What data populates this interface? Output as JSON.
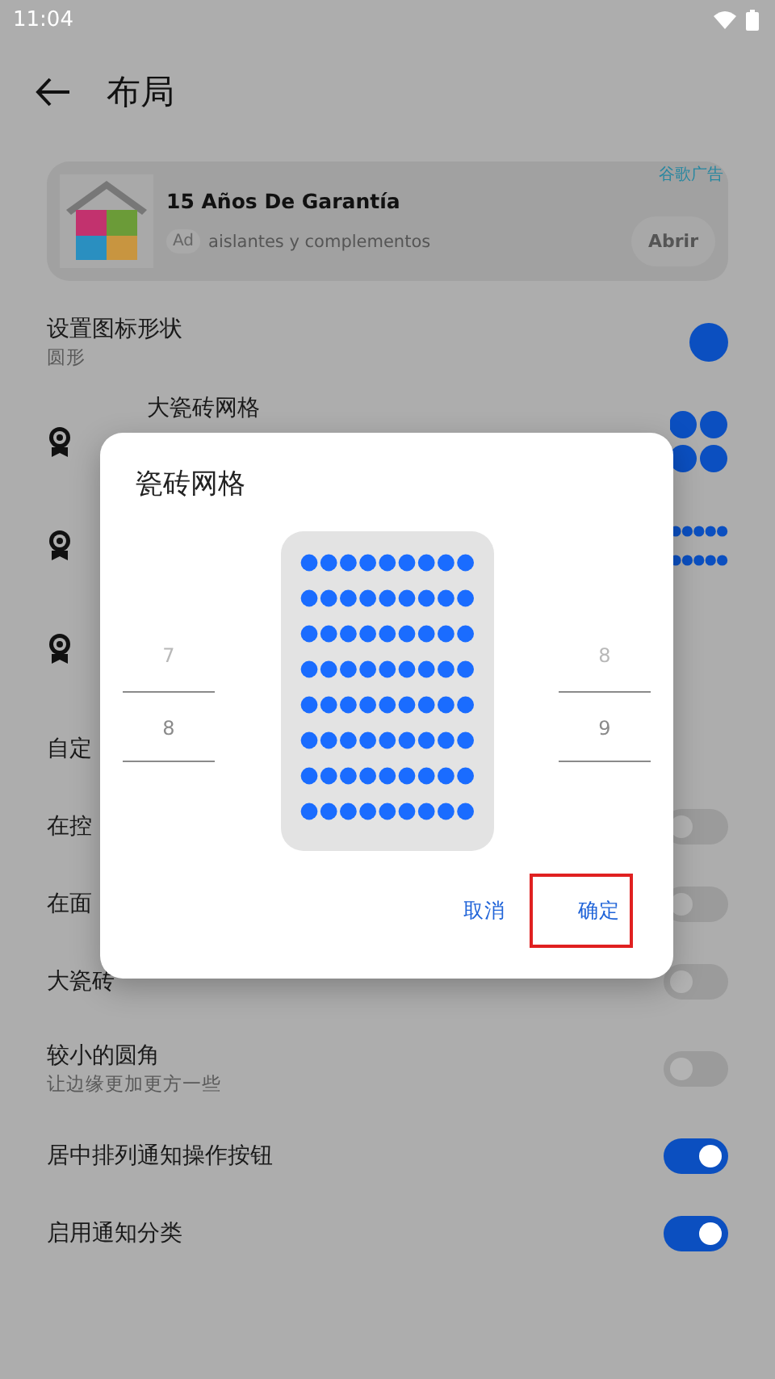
{
  "status_bar": {
    "time": "11:04"
  },
  "header": {
    "title": "布局"
  },
  "ad": {
    "label": "谷歌广告",
    "title": "15 Años De Garantía",
    "badge": "Ad",
    "text": "aislantes y complementos",
    "button": "Abrir"
  },
  "settings": [
    {
      "kind": "shape",
      "title": "设置图标形状",
      "subtitle": "圆形"
    },
    {
      "kind": "tile_large",
      "title": "大瓷砖网格"
    },
    {
      "kind": "tile_small"
    },
    {
      "kind": "tile"
    },
    {
      "kind": "plain",
      "title": "自定"
    },
    {
      "kind": "toggle",
      "title": "在控",
      "on": false
    },
    {
      "kind": "toggle",
      "title": "在面",
      "on": false
    },
    {
      "kind": "toggle",
      "title": "大瓷砖",
      "on": false
    },
    {
      "kind": "toggle",
      "title": "较小的圆角",
      "subtitle": "让边缘更加更方一些",
      "on": false
    },
    {
      "kind": "toggle",
      "title": "居中排列通知操作按钮",
      "on": true
    },
    {
      "kind": "toggle",
      "title": "启用通知分类",
      "on": true
    }
  ],
  "dialog": {
    "title": "瓷砖网格",
    "left_picker": [
      {
        "value": "7",
        "selected": false
      },
      {
        "value": "8",
        "selected": true
      }
    ],
    "right_picker": [
      {
        "value": "8",
        "selected": false
      },
      {
        "value": "9",
        "selected": true
      }
    ],
    "buttons": [
      {
        "label": "取消",
        "highlighted": false
      },
      {
        "label": "确定",
        "highlighted": true
      }
    ]
  }
}
